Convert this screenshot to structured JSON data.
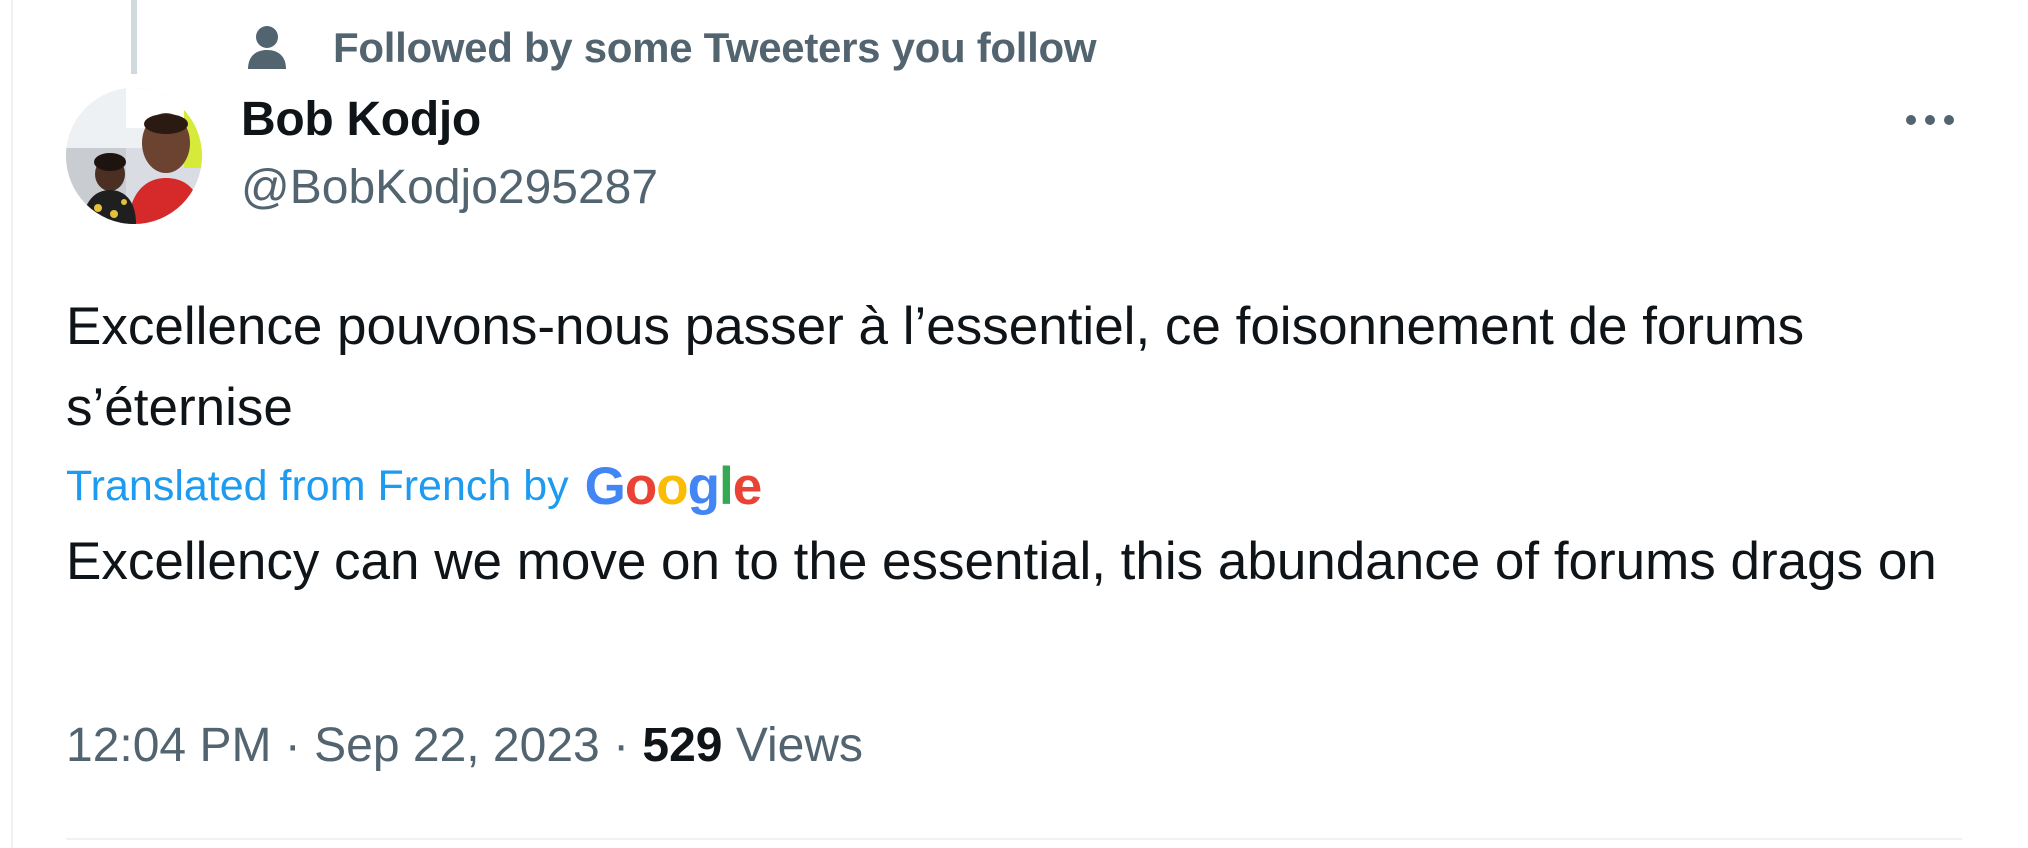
{
  "social_context": {
    "icon": "person-icon",
    "text": "Followed by some Tweeters you follow"
  },
  "author": {
    "display_name": "Bob Kodjo",
    "handle": "@BobKodjo295287"
  },
  "more_button": {
    "icon": "more-horizontal-icon"
  },
  "tweet": {
    "text": "Excellence pouvons-nous passer à l’essentiel, ce foisonnement de forums s’éternise"
  },
  "translation": {
    "label": "Translated from French by",
    "provider": "Google",
    "text": "Excellency can we move on to the essential, this abundance of forums drags on"
  },
  "meta": {
    "time": "12:04 PM",
    "separator": "·",
    "date": "Sep 22, 2023",
    "views_count": "529",
    "views_label": "Views"
  },
  "colors": {
    "text_primary": "#0f1419",
    "text_secondary": "#536471",
    "link_blue": "#1d9bf0",
    "google_blue": "#4285F4",
    "google_red": "#EA4335",
    "google_yellow": "#FBBC05",
    "google_green": "#34A853"
  }
}
